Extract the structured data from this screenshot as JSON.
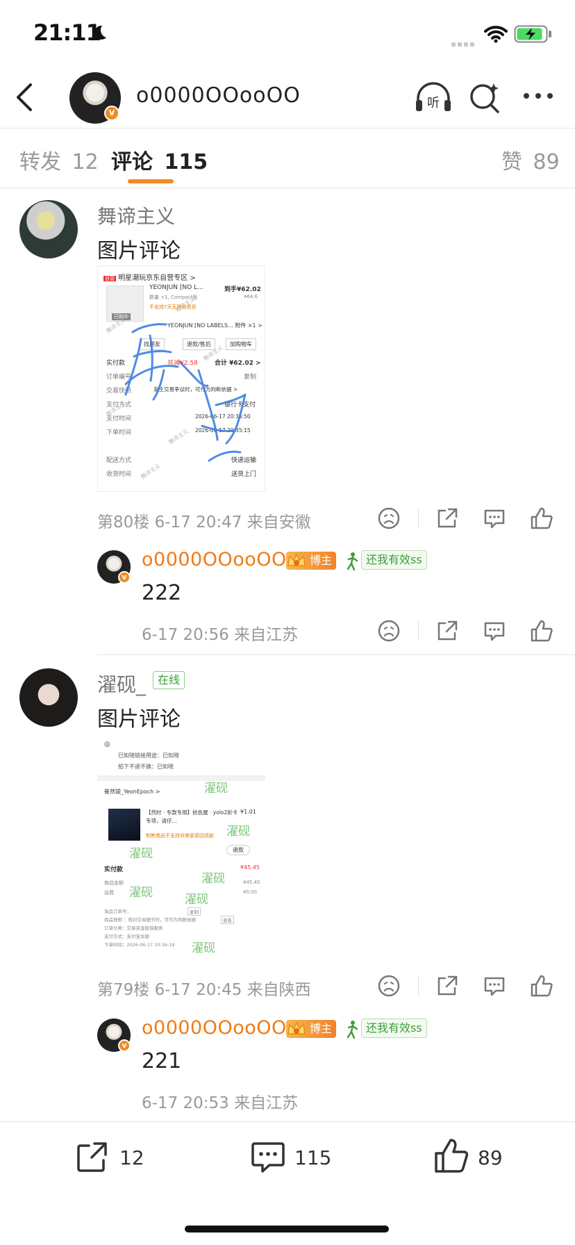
{
  "status_bar": {
    "time": "21:11"
  },
  "header": {
    "title": "o0000OOooOO"
  },
  "tabs": {
    "repost_label": "转发",
    "repost_count": "12",
    "comment_label": "评论",
    "comment_count": "115",
    "like_label": "赞",
    "like_count": "89"
  },
  "comments": [
    {
      "author": "舞谛主义",
      "text": "图片评论",
      "meta": "第80楼 6-17 20:47 来自安徽",
      "image": {
        "header": "明星潮玩京东自营专区 >",
        "product": "YEONJUN [NO L...",
        "price_label": "到手¥62.02",
        "sub_price": "¥64.6",
        "spec": "数量 ×1, Compact版",
        "notice": "不支持7天无理由退货",
        "status": "已购中",
        "line2": "YEONJUN [NO LABELS... 附件 ×1 >",
        "btn1": "找朋友",
        "btn2": "退款/售后",
        "btn3": "加购物车",
        "paid_label": "实付款",
        "paid_reduce": "共减¥2.58",
        "paid_total": "合计 ¥62.02 >",
        "order_no": "订单编号",
        "copy": "复制",
        "snapshot": "交易快照",
        "snapshot_right": "发生交易争议时，可作为判断依据 >",
        "pay_method": "支付方式",
        "pay_method_val": "银行卡支付",
        "pay_time": "支付时间",
        "pay_time_val": "2026-06-17 20:35:50",
        "order_time": "下单时间",
        "order_time_val": "2026-06-17 20:35:15",
        "ship": "配送方式",
        "ship_val": "快递运输",
        "receive": "收货时间",
        "receive_val": "送货上门",
        "watermark": "舞谛主义",
        "signature": "舞谛"
      },
      "reply": {
        "author": "o0000OOooOO",
        "badge": "博主",
        "tag": "还我有效ss",
        "text": "222",
        "meta": "6-17 20:56 来自江苏"
      }
    },
    {
      "author": "濯砚_",
      "online": "在线",
      "text": "图片评论",
      "meta": "第79楼 6-17 20:45 来自陕西",
      "image": {
        "line1": "已知晓链接用途：已知晓",
        "line2": "拍下不退不换：已知晓",
        "shop": "崔然竣_YeonEpoch >",
        "product": "【然时 · 专款专用】拾色屋 · yolo2折卡专项，请仔...",
        "price": "¥1.01",
        "notice": "制售商品不支持非商家原因退款",
        "refund": "退款",
        "paid_label": "实付款",
        "paid_val": "¥45.45",
        "goods_amount": "商品金额",
        "goods_val": "¥45.45",
        "freight": "运费",
        "freight_val": "¥0.00",
        "order_no": "淘品订单号：",
        "copy": "复制",
        "snapshot": "商品快照 ：核对交易细节时，可作为判断依据",
        "view": "查看",
        "order_class": "订单分类：交易资金担保服务",
        "pay_method": "支付方式：支付宝余额",
        "order_time": "下单时间：2026-06-17 20:36:19",
        "watermark": "濯砚"
      },
      "reply": {
        "author": "o0000OOooOO",
        "badge": "博主",
        "tag": "还我有效ss",
        "text": "221",
        "meta": "6-17 20:53 来自江苏"
      }
    }
  ],
  "bottom_bar": {
    "repost": "12",
    "comment": "115",
    "like": "89"
  },
  "colors": {
    "accent": "#f28a26",
    "name_orange": "#f07a16",
    "green_tag": "#3e9c3a",
    "muted": "#999999"
  }
}
